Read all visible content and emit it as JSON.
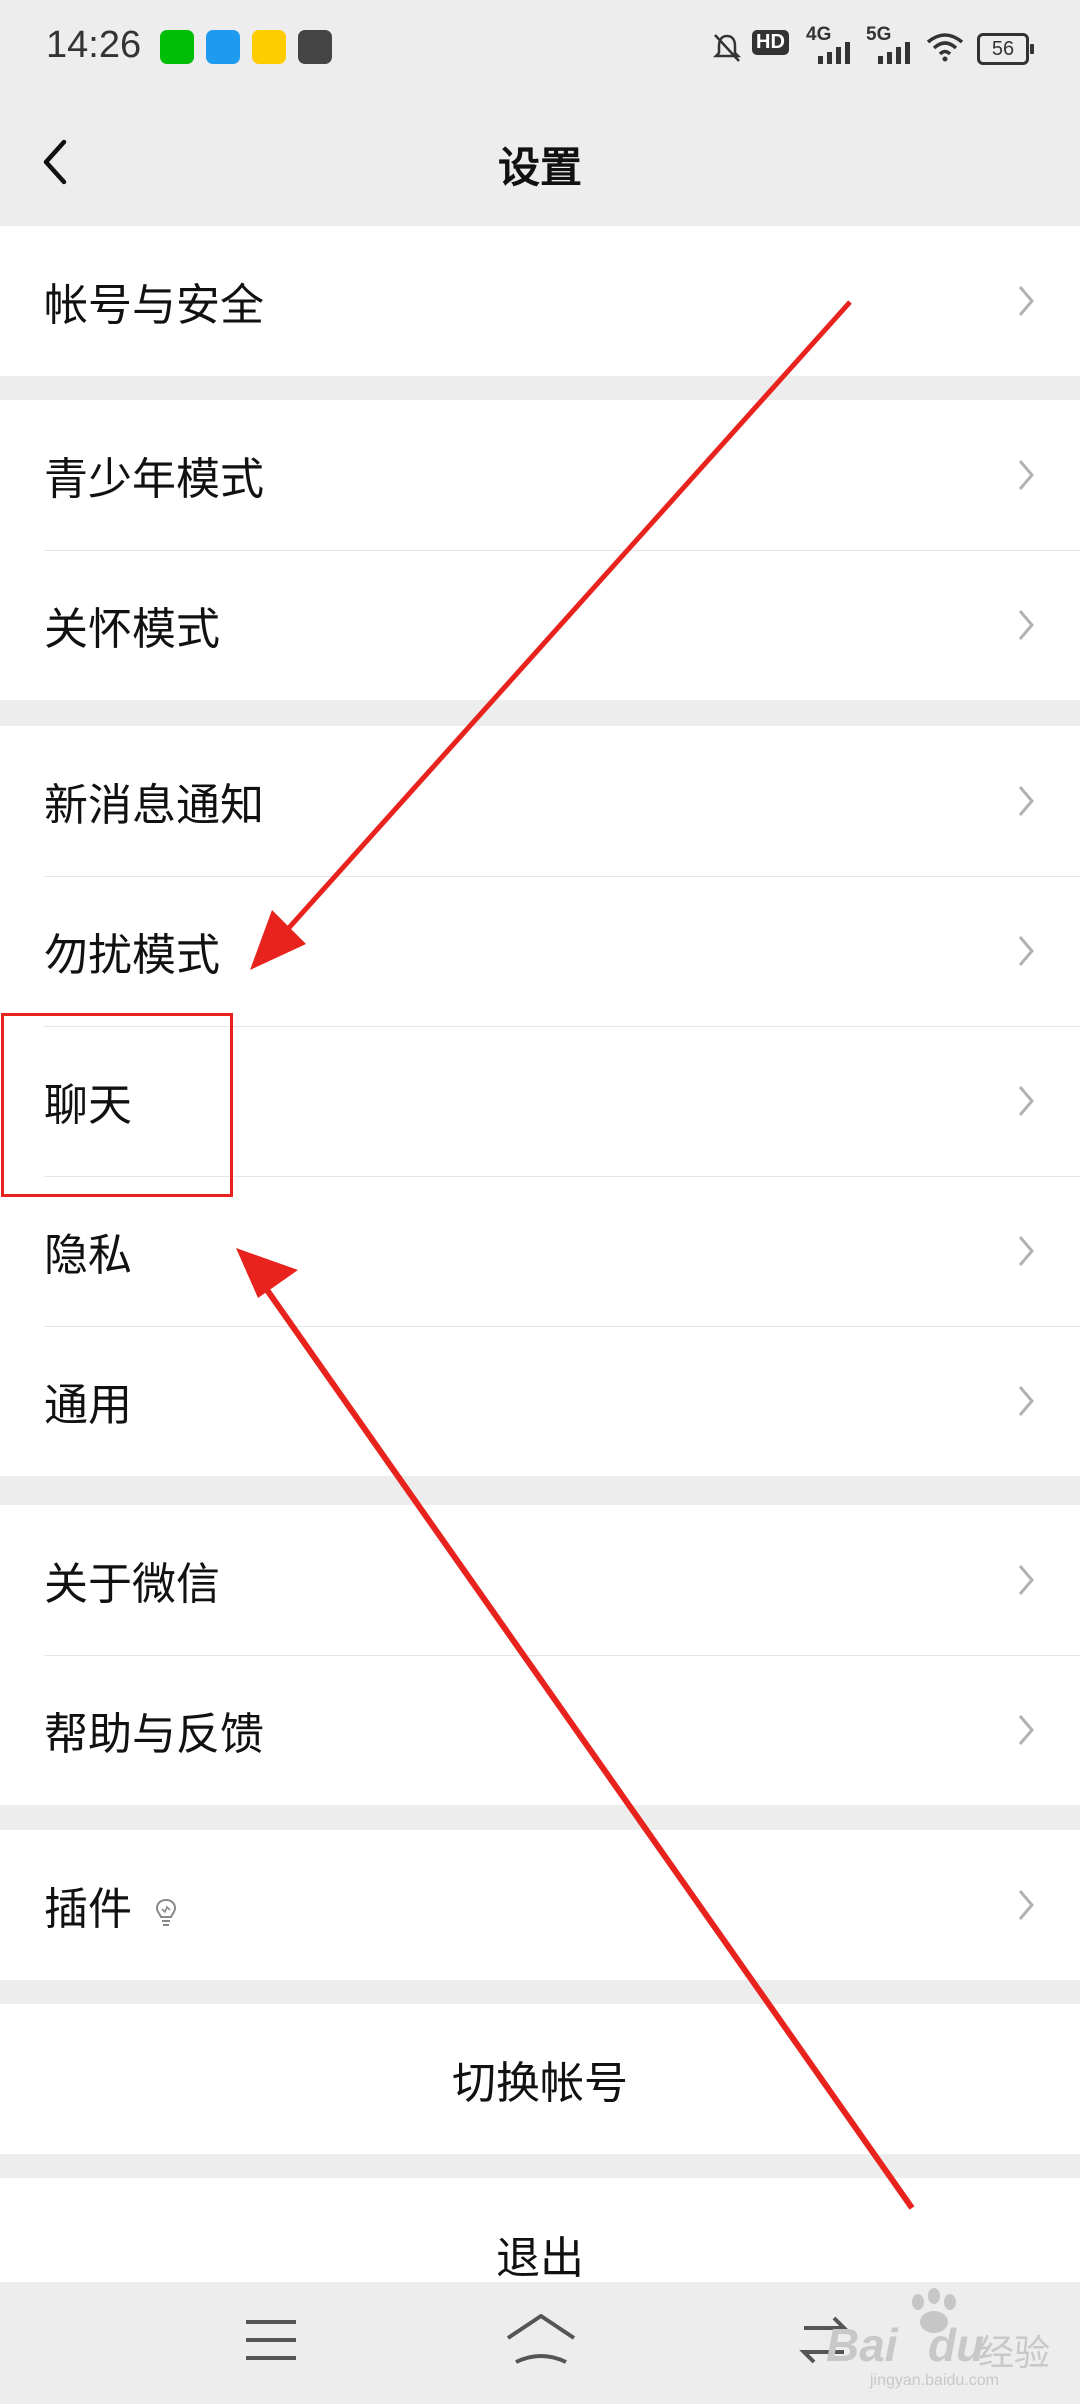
{
  "status_bar": {
    "time": "14:26",
    "network_4g": "4G",
    "network_5g": "5G",
    "hd": "HD",
    "battery": "56",
    "icons": [
      "iqiyi-icon",
      "ele-icon",
      "bear-app-icon",
      "shop-bag-icon",
      "mute-notification-icon",
      "hd-voice-icon",
      "signal-4g-icon",
      "signal-5g-icon",
      "wifi-icon",
      "battery-icon"
    ]
  },
  "header": {
    "title": "设置",
    "back_icon": "chevron-left-icon"
  },
  "groups": [
    {
      "items": [
        {
          "label": "帐号与安全"
        }
      ]
    },
    {
      "items": [
        {
          "label": "青少年模式"
        },
        {
          "label": "关怀模式"
        }
      ]
    },
    {
      "items": [
        {
          "label": "新消息通知"
        },
        {
          "label": "勿扰模式"
        },
        {
          "label": "聊天"
        },
        {
          "label": "隐私"
        },
        {
          "label": "通用"
        }
      ]
    },
    {
      "items": [
        {
          "label": "关于微信"
        },
        {
          "label": "帮助与反馈"
        }
      ]
    },
    {
      "items": [
        {
          "label": "插件",
          "icon": "lightbulb-icon"
        }
      ]
    }
  ],
  "actions": {
    "switch_account": "切换帐号",
    "logout": "退出"
  },
  "nav_bar": {
    "icons": [
      "menu-icon",
      "home-icon",
      "back-nav-icon"
    ]
  },
  "annotation": {
    "color": "#e8231e"
  },
  "watermark": {
    "brand": "Bai",
    "brand2": "du",
    "sub": "经验",
    "url": "jingyan.baidu.com"
  }
}
